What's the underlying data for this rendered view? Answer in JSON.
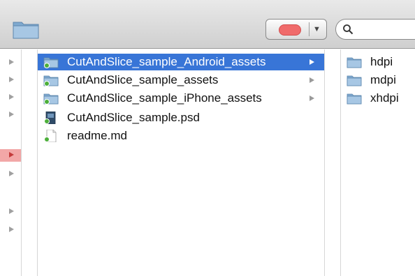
{
  "toolbar": {
    "search_value": "",
    "label_color": "#f06b6b"
  },
  "main_column": {
    "items": [
      {
        "name": "CutAndSlice_sample_Android_assets",
        "kind": "folder",
        "selected": true,
        "has_children": true
      },
      {
        "name": "CutAndSlice_sample_assets",
        "kind": "folder",
        "selected": false,
        "has_children": true
      },
      {
        "name": "CutAndSlice_sample_iPhone_assets",
        "kind": "folder",
        "selected": false,
        "has_children": true
      },
      {
        "name": "CutAndSlice_sample.psd",
        "kind": "psd-file",
        "selected": false,
        "has_children": false
      },
      {
        "name": "readme.md",
        "kind": "text-file",
        "selected": false,
        "has_children": false
      }
    ]
  },
  "right_column": {
    "items": [
      {
        "name": "hdpi",
        "kind": "folder"
      },
      {
        "name": "mdpi",
        "kind": "folder"
      },
      {
        "name": "xhdpi",
        "kind": "folder"
      }
    ]
  },
  "colors": {
    "selection": "#3875d7",
    "folder": "#8fb6d8",
    "badge": "#4caf3a"
  }
}
